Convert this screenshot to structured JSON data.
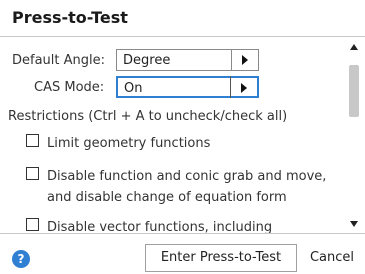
{
  "dialog": {
    "title": "Press-to-Test"
  },
  "settings": {
    "default_angle_label": "Default Angle:",
    "default_angle_value": "Degree",
    "cas_mode_label": "CAS Mode:",
    "cas_mode_value": "On",
    "restrictions_label": "Restrictions (Ctrl + A to uncheck/check all)"
  },
  "restrictions": [
    {
      "lines": [
        "Limit geometry functions"
      ],
      "checked": false
    },
    {
      "lines": [
        "Disable function and conic grab and move,",
        "and disable change of equation form"
      ],
      "checked": false
    },
    {
      "lines": [
        "Disable vector functions, including"
      ],
      "checked": false
    }
  ],
  "footer": {
    "help_icon": "?",
    "enter_button": "Enter Press-to-Test",
    "cancel_button": "Cancel"
  },
  "colors": {
    "accent": "#2f7fd3",
    "divider": "#c8c8c8"
  }
}
